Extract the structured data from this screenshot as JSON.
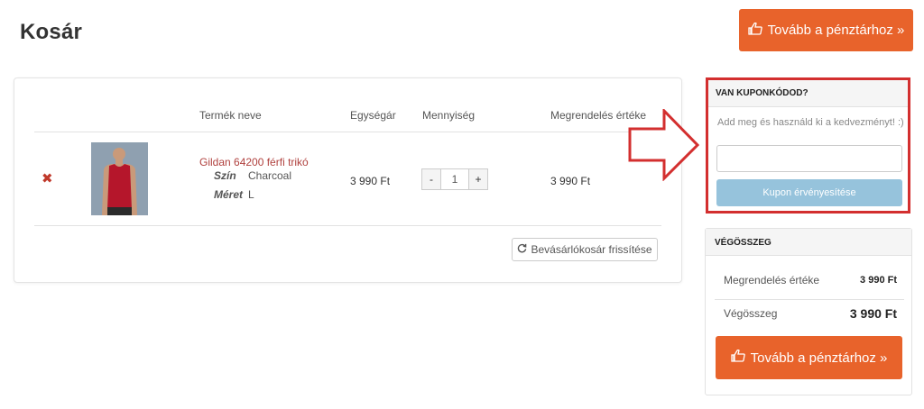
{
  "page": {
    "title": "Kosár"
  },
  "checkout": {
    "label": "Tovább a pénztárhoz »"
  },
  "cart": {
    "columns": {
      "name": "Termék neve",
      "unit_price": "Egységár",
      "quantity": "Mennyiség",
      "order_value": "Megrendelés értéke"
    },
    "items": [
      {
        "name": "Gildan 64200 férfi trikó",
        "color_label": "Szín",
        "color_value": "Charcoal",
        "size_label": "Méret",
        "size_value": "L",
        "unit_price": "3 990 Ft",
        "quantity": "1",
        "total": "3 990 Ft"
      }
    ],
    "qty_minus": "-",
    "qty_plus": "+",
    "refresh_label": "Bevásárlókosár frissítése"
  },
  "coupon": {
    "title": "VAN KUPONKÓDOD?",
    "text": "Add meg és használd ki a kedvezményt! :)",
    "input_value": "",
    "button_label": "Kupon érvényesítése"
  },
  "totals": {
    "title": "VÉGÖSSZEG",
    "order_value_label": "Megrendelés értéke",
    "order_value": "3 990 Ft",
    "grand_total_label": "Végösszeg",
    "grand_total": "3 990 Ft"
  },
  "colors": {
    "accent": "#e8632b",
    "coupon_button": "#96c3dc",
    "highlight": "#d32f2f",
    "product_link": "#b0413e"
  },
  "icons": {
    "checkout": "thumbs-up-pointing-icon",
    "remove": "close-icon",
    "refresh": "refresh-icon",
    "callout": "arrow-right-icon"
  }
}
